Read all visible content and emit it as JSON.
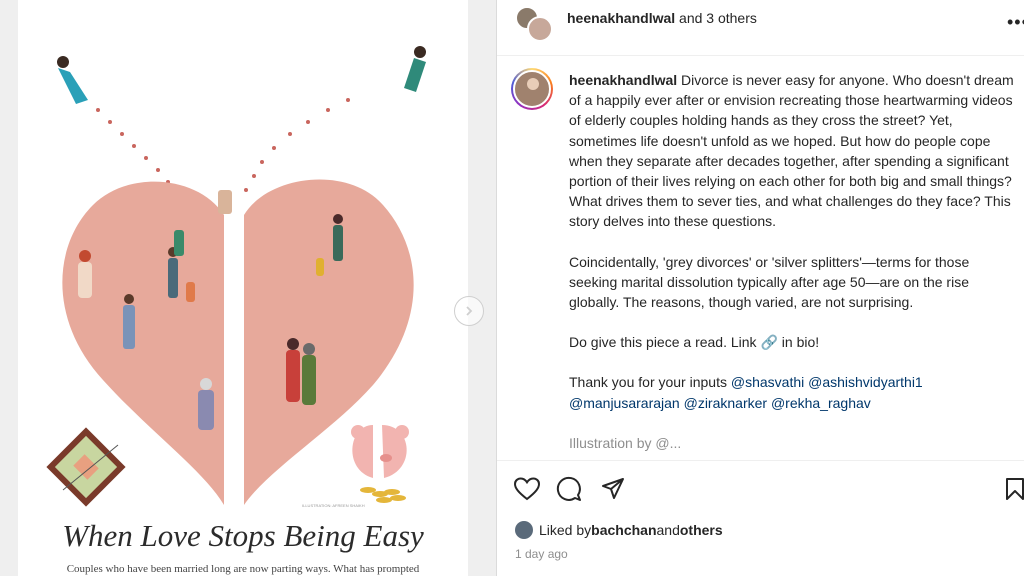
{
  "media": {
    "headline": "When Love Stops Being Easy",
    "subline": "Couples who have been married long are now parting ways. What has prompted",
    "credit": "ILLUSTRATION: AFREEN SHAIKH"
  },
  "header": {
    "username": "heenakhandlwal",
    "others_text": " and 3 others",
    "more_icon": "more-horizontal-icon"
  },
  "caption": {
    "username": "heenakhandlwal",
    "paragraph1": " Divorce is never easy for anyone. Who doesn't dream of a happily ever after or envision recreating those heartwarming videos of elderly couples holding hands as they cross the street? Yet, sometimes life doesn't unfold as we hoped. But how do people cope when they separate after decades together, after spending a significant portion of their lives relying on each other for both big and small things? What drives them to sever ties, and what challenges do they face? This story delves into these questions.",
    "paragraph2": "Coincidentally, 'grey divorces' or 'silver splitters'—terms for those seeking marital dissolution typically after age 50—are on the rise globally. The reasons, though varied, are not surprising.",
    "paragraph3_a": "Do give this piece a read. Link ",
    "paragraph3_b": " in bio!",
    "paragraph4": "Thank you for your inputs ",
    "mentions": [
      "@shasvathi",
      "@ashishvidyarthi1",
      "@manjusararajan",
      "@ziraknarker",
      "@rekha_raghav"
    ],
    "paragraph5_partial": "Illustration by @..."
  },
  "actions": {
    "like_icon": "heart-icon",
    "comment_icon": "comment-icon",
    "share_icon": "share-icon",
    "save_icon": "bookmark-icon"
  },
  "likes": {
    "prefix": "Liked by ",
    "user": "bachchan",
    "middle": " and ",
    "others": "others"
  },
  "timestamp": "1 day ago"
}
